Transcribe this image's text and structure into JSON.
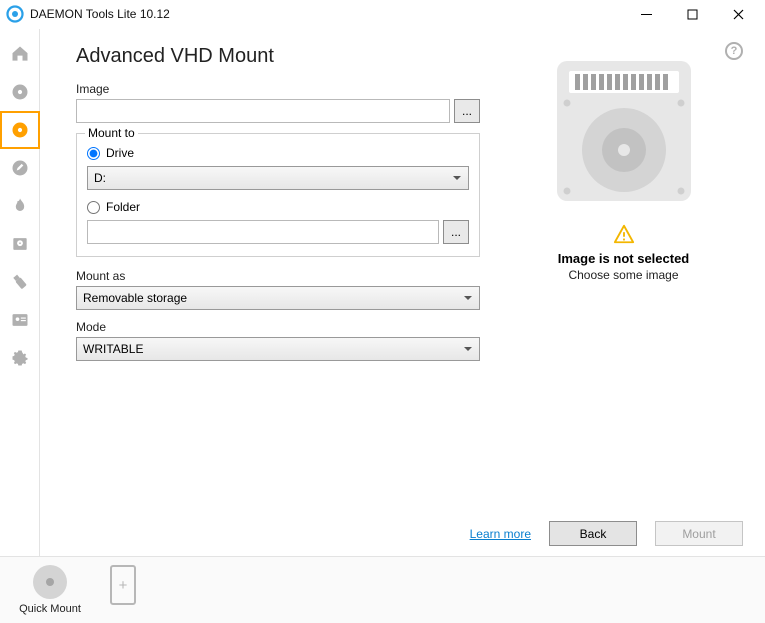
{
  "titlebar": {
    "title": "DAEMON Tools Lite 10.12"
  },
  "page": {
    "title": "Advanced VHD Mount"
  },
  "image_field": {
    "label": "Image",
    "value": "",
    "browse": "..."
  },
  "mount_to": {
    "label": "Mount to",
    "drive_label": "Drive",
    "drive_value": "D:",
    "folder_label": "Folder",
    "folder_value": "",
    "folder_browse": "..."
  },
  "mount_as": {
    "label": "Mount as",
    "value": "Removable storage"
  },
  "mode": {
    "label": "Mode",
    "value": "WRITABLE"
  },
  "info": {
    "title": "Image is not selected",
    "subtitle": "Choose some image"
  },
  "actions": {
    "learn_more": "Learn more",
    "back": "Back",
    "mount": "Mount"
  },
  "bottombar": {
    "quick_mount": "Quick Mount"
  }
}
